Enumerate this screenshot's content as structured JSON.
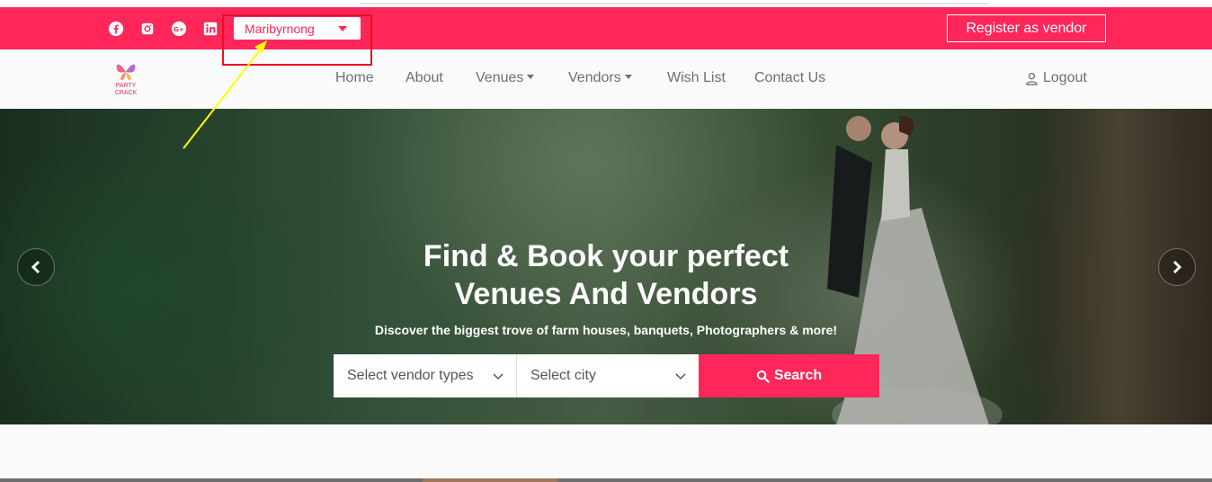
{
  "topbar": {
    "location_selected": "Maribyrnong",
    "register_vendor_label": "Register as vendor",
    "social_icons": [
      "facebook-icon",
      "instagram-icon",
      "google-plus-icon",
      "linkedin-icon"
    ]
  },
  "nav": {
    "logo_line1": "PARTY",
    "logo_line2": "CRACK",
    "items": [
      {
        "label": "Home",
        "dropdown": false
      },
      {
        "label": "About",
        "dropdown": false
      },
      {
        "label": "Venues",
        "dropdown": true
      },
      {
        "label": "Vendors",
        "dropdown": true
      },
      {
        "label": "Wish List",
        "dropdown": false
      },
      {
        "label": "Contact Us",
        "dropdown": false
      }
    ],
    "logout_label": "Logout"
  },
  "hero": {
    "title_line1": "Find & Book your perfect",
    "title_line2": "Venues And Vendors",
    "subtitle": "Discover the biggest trove of farm houses, banquets, Photographers & more!",
    "vendor_type_placeholder": "Select vendor types",
    "city_placeholder": "Select city",
    "search_label": "Search"
  },
  "colors": {
    "brand": "#ff2659",
    "annotation": "#e8111e",
    "arrow": "#ffff00"
  }
}
